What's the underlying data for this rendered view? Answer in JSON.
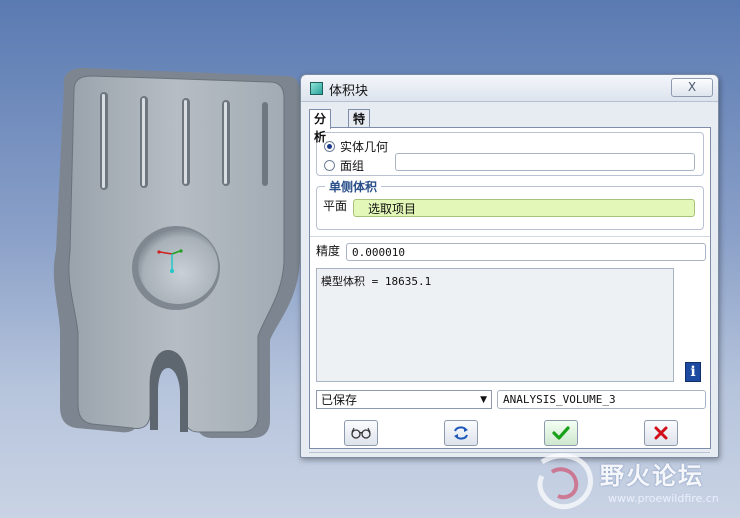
{
  "dialog": {
    "title": "体积块",
    "close_label": "X",
    "tabs": [
      {
        "label": "分析",
        "active": true
      },
      {
        "label": "特征",
        "active": false
      }
    ],
    "solid_geometry_label": "实体几何",
    "quilt_label": "面组",
    "quilt_value": "",
    "one_sided_volume_legend": "单侧体积",
    "plane_label": "平面",
    "plane_value": "选取项目",
    "precision_label": "精度",
    "precision_value": "0.000010",
    "result_text": "模型体积 = 18635.1",
    "info_icon": "i",
    "saved_select_value": "已保存",
    "analysis_name": "ANALYSIS_VOLUME_3"
  },
  "colors": {
    "accent": "#2a4f8a",
    "plane_field_bg": "#e3f7b8",
    "ok_green": "#1aa11a",
    "cancel_red": "#d10f1a"
  },
  "watermark": {
    "text": "野火论坛",
    "url": "www.proewildfire.cn"
  }
}
